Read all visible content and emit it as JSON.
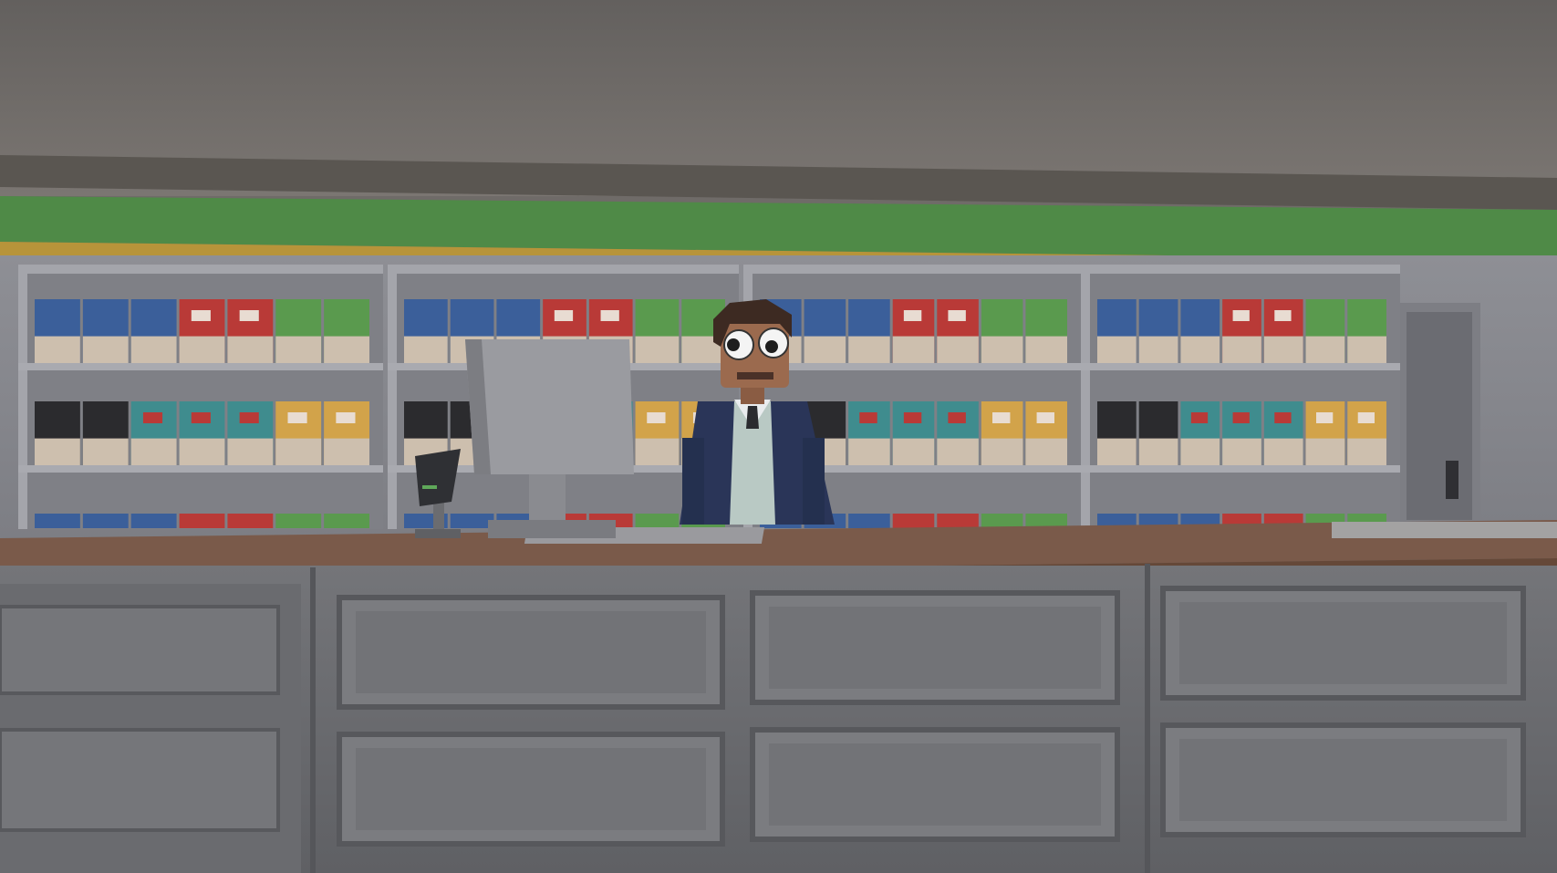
{
  "scene": {
    "setting": "shop-interior",
    "shopkeeper": "npc-shopkeeper"
  },
  "palette": {
    "ceiling": "#6f6b68",
    "trim_green": "#4f8a47",
    "trim_gold": "#b7943a",
    "wall": "#8f9096",
    "shelf": "#9fa0a6",
    "counter_top": "#7a5a4a",
    "counter_front": "#6e6f73",
    "box_blue": "#3b5f9a",
    "box_red": "#b93a37",
    "box_green": "#5a9a4e",
    "box_teal": "#3f8c8e",
    "box_yellow": "#d2a34a",
    "box_black": "#2b2b2e",
    "suit": "#2a3558",
    "skin": "#9b6a4e",
    "hair": "#3d2a22"
  },
  "icons": {
    "monitor": "pos-monitor-icon",
    "card_reader": "card-reader-icon"
  }
}
